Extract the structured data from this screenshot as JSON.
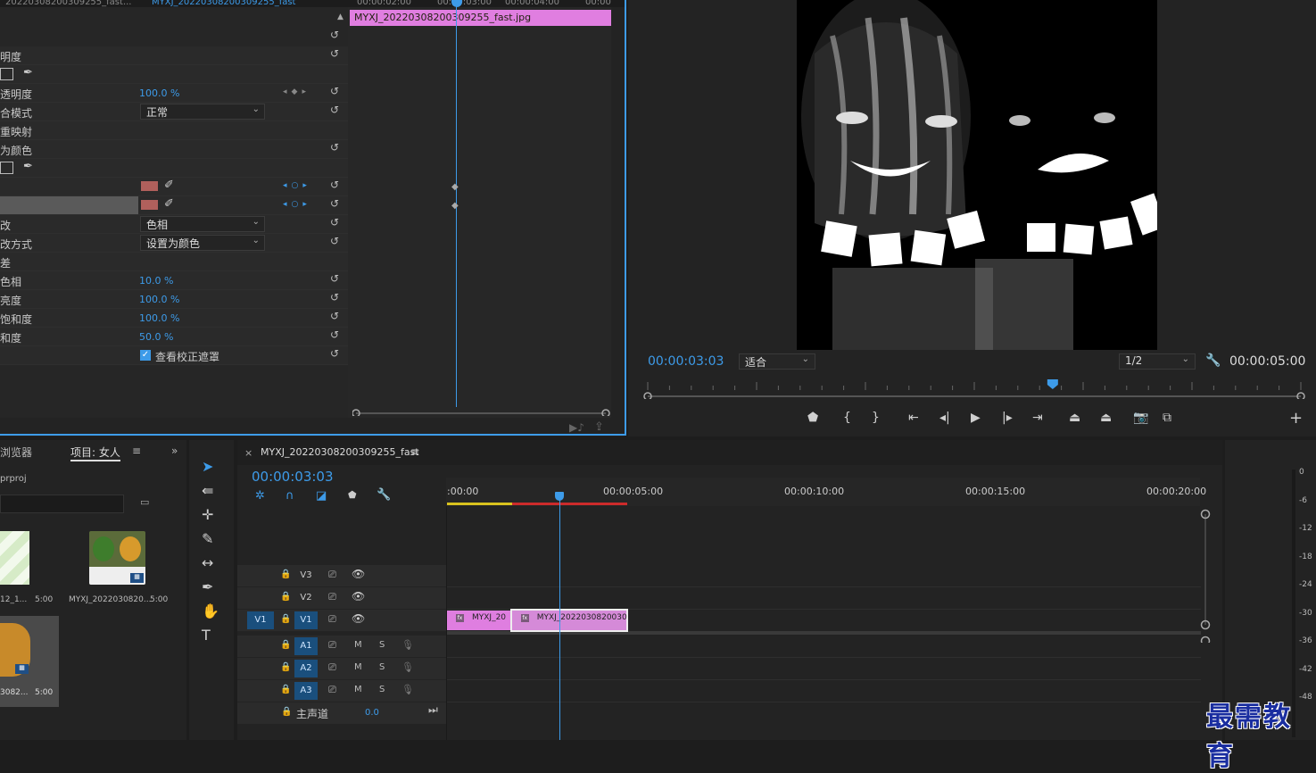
{
  "effect_controls": {
    "tab1": "20220308200309255_fast...",
    "tab2": "MYXJ_20220308200309255_fast",
    "clip_name": "MYXJ_20220308200309255_fast.jpg",
    "ruler_labels": [
      "00:00:02:00",
      "00:00:03:00",
      "00:00:04:00",
      "00:00"
    ],
    "rows": [
      {
        "label": "明度"
      },
      {
        "label": ""
      },
      {
        "label": "透明度",
        "value": "100.0 %"
      },
      {
        "label": "合模式",
        "dropdown": "正常"
      },
      {
        "label": "重映射"
      },
      {
        "label": "为颜色"
      },
      {
        "label": ""
      },
      {
        "label": ""
      },
      {
        "label": ""
      },
      {
        "label": "改",
        "dropdown": "色相"
      },
      {
        "label": "改方式",
        "dropdown": "设置为颜色"
      },
      {
        "label": "差"
      },
      {
        "label": "色相",
        "value": "10.0 %"
      },
      {
        "label": "亮度",
        "value": "100.0 %"
      },
      {
        "label": "饱和度",
        "value": "100.0 %"
      },
      {
        "label": "和度",
        "value": "50.0 %"
      },
      {
        "label": "",
        "checkbox": "查看校正遮罩"
      }
    ]
  },
  "program_monitor": {
    "timecode": "00:00:03:03",
    "fit": "适合",
    "resolution": "1/2",
    "duration": "00:00:05:00",
    "playhead_fraction": 0.62
  },
  "project": {
    "tab_browser": "浏览器",
    "tab_project": "项目: 女人",
    "file": "prproj",
    "items": [
      {
        "name": "12_1...",
        "duration": "5:00"
      },
      {
        "name": "MYXJ_2022030820...",
        "duration": "5:00"
      },
      {
        "name": "3082...",
        "duration": "5:00"
      }
    ]
  },
  "timeline": {
    "sequence": "MYXJ_20220308200309255_fast",
    "timecode": "00:00:03:03",
    "ruler": [
      ":00:00",
      "00:00:05:00",
      "00:00:10:00",
      "00:00:15:00",
      "00:00:20:00"
    ],
    "video_tracks": [
      "V3",
      "V2",
      "V1"
    ],
    "audio_tracks": [
      "A1",
      "A2",
      "A3"
    ],
    "source_patch": "V1",
    "master": "主声道",
    "master_value": "0.0",
    "clips": [
      {
        "label": "MYXJ_20",
        "start_s": 0,
        "end_s": 1.8
      },
      {
        "label": "MYXJ_2022030820030",
        "start_s": 1.8,
        "end_s": 5.0
      }
    ],
    "mute_label": "M",
    "solo_label": "S"
  },
  "meters": {
    "ticks": [
      "0",
      "-6",
      "-12",
      "-18",
      "-24",
      "-30",
      "-36",
      "-42",
      "-48"
    ]
  },
  "watermark": "最需教育",
  "colors": {
    "accent": "#3d9be9",
    "clip": "#e07ee0",
    "track_on": "#1a4f7d"
  }
}
